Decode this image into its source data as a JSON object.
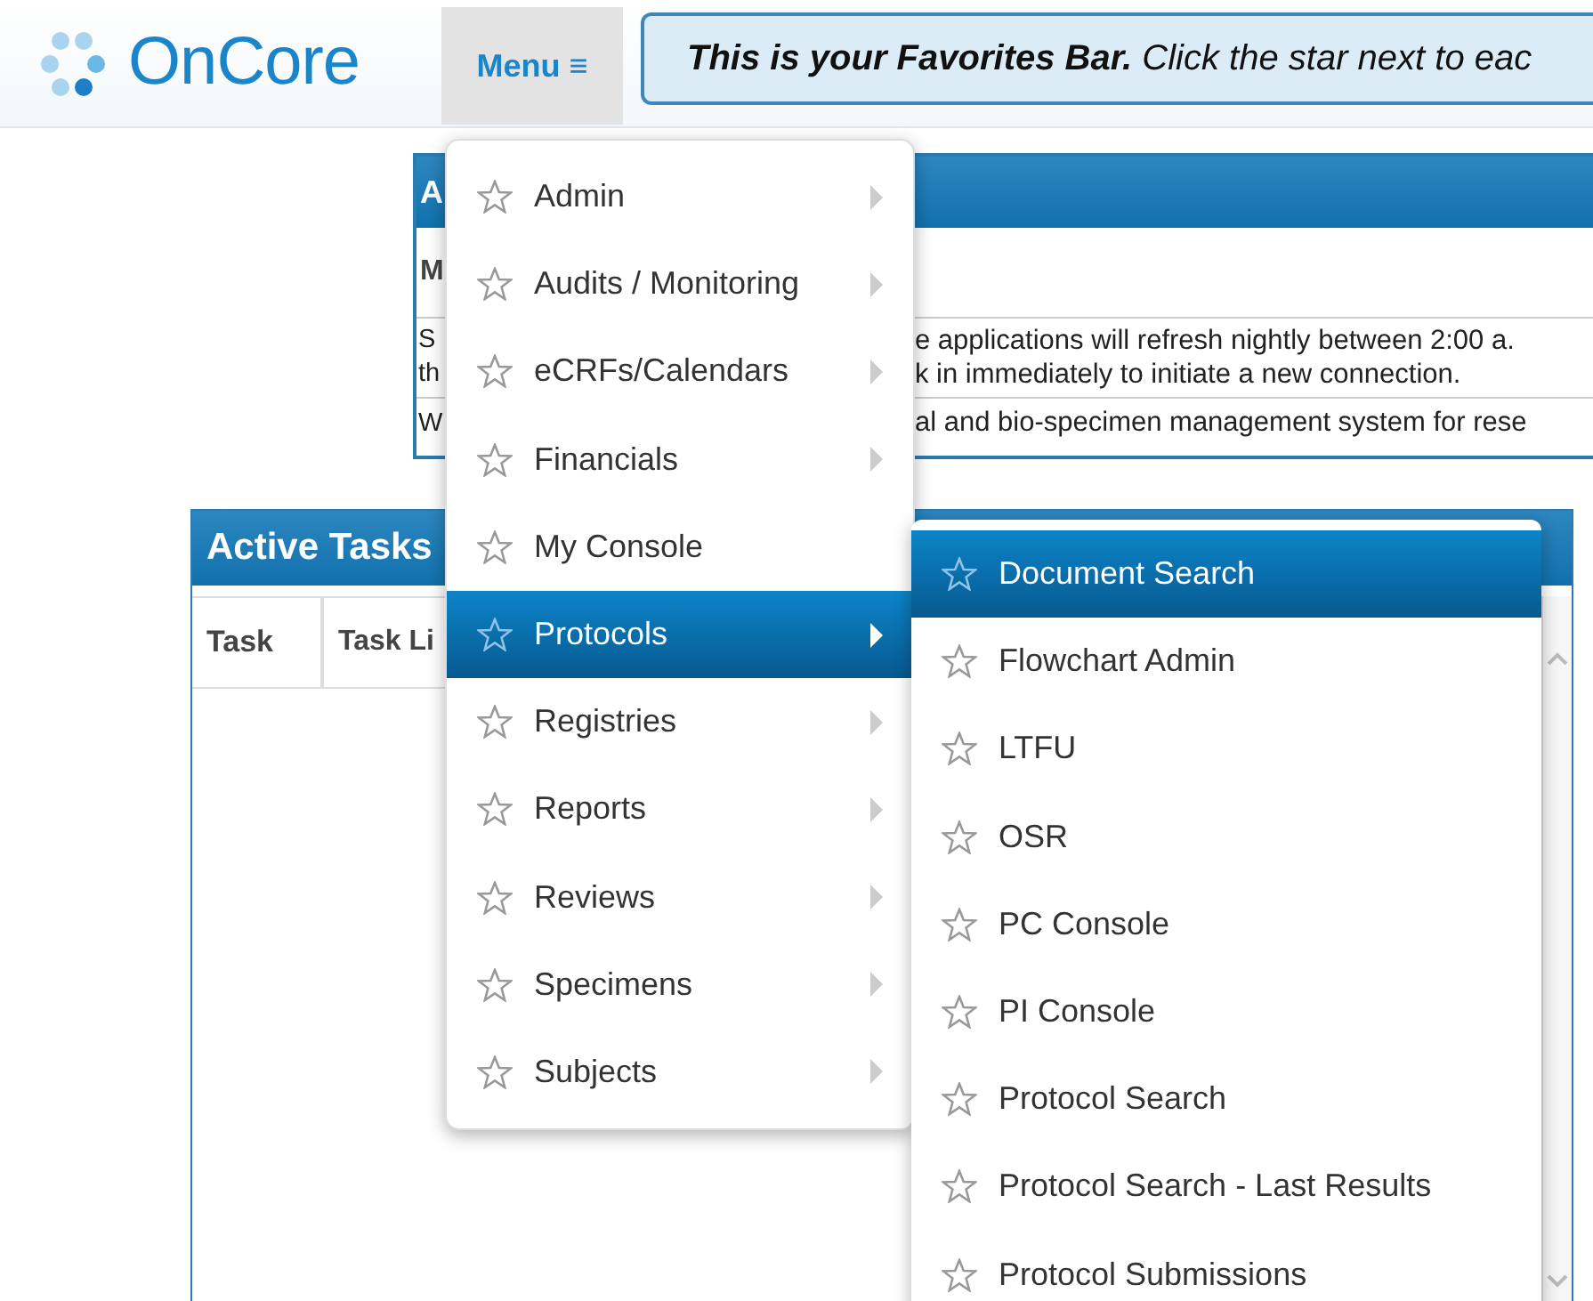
{
  "header": {
    "logo": "OnCore",
    "menu_button": "Menu ≡",
    "favorites_bar": "**This is your Favorites Bar.** Click the star next to eac"
  },
  "announcements": {
    "title": "A",
    "subheading": "M",
    "rows": [
      {
        "left": [
          "S",
          "th"
        ],
        "right": [
          "e applications will refresh nightly between 2:00 a.",
          "k in immediately to initiate a new connection."
        ]
      },
      {
        "left": [
          "W"
        ],
        "right": [
          "al and bio-specimen management system for rese"
        ]
      }
    ]
  },
  "active_tasks": {
    "title": "Active Tasks",
    "columns": [
      "Task",
      "Task Li"
    ]
  },
  "menu": {
    "items": [
      {
        "label": "Admin",
        "has_submenu": true,
        "selected": false
      },
      {
        "label": "Audits / Monitoring",
        "has_submenu": true,
        "selected": false
      },
      {
        "label": "eCRFs/Calendars",
        "has_submenu": true,
        "selected": false
      },
      {
        "label": "Financials",
        "has_submenu": true,
        "selected": false
      },
      {
        "label": "My Console",
        "has_submenu": false,
        "selected": false
      },
      {
        "label": "Protocols",
        "has_submenu": true,
        "selected": true
      },
      {
        "label": "Registries",
        "has_submenu": true,
        "selected": false
      },
      {
        "label": "Reports",
        "has_submenu": true,
        "selected": false
      },
      {
        "label": "Reviews",
        "has_submenu": true,
        "selected": false
      },
      {
        "label": "Specimens",
        "has_submenu": true,
        "selected": false
      },
      {
        "label": "Subjects",
        "has_submenu": true,
        "selected": false
      }
    ]
  },
  "submenu": {
    "items": [
      {
        "label": "Document Search",
        "selected": true
      },
      {
        "label": "Flowchart Admin",
        "selected": false
      },
      {
        "label": "LTFU",
        "selected": false
      },
      {
        "label": "OSR",
        "selected": false
      },
      {
        "label": "PC Console",
        "selected": false
      },
      {
        "label": "PI Console",
        "selected": false
      },
      {
        "label": "Protocol Search",
        "selected": false
      },
      {
        "label": "Protocol Search - Last Results",
        "selected": false
      },
      {
        "label": "Protocol Submissions",
        "selected": false
      }
    ]
  }
}
